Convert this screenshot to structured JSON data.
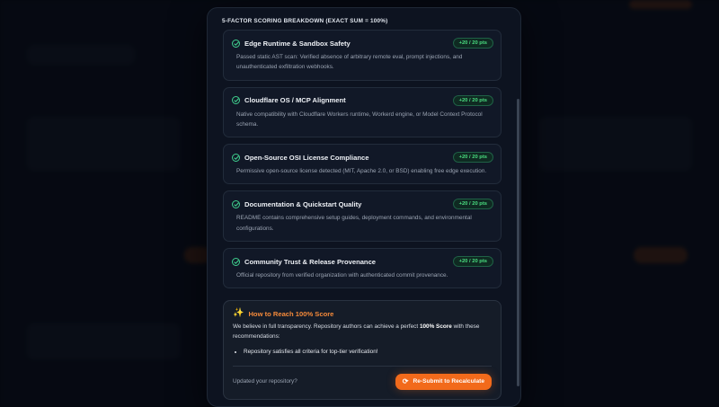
{
  "modal": {
    "section_title": "5-FACTOR SCORING BREAKDOWN (EXACT SUM = 100%)",
    "criteria": [
      {
        "title": "Edge Runtime & Sandbox Safety",
        "points": "+20 / 20 pts",
        "description": "Passed static AST scan: Verified absence of arbitrary remote eval, prompt injections, and unauthenticated exfiltration webhooks."
      },
      {
        "title": "Cloudflare OS / MCP Alignment",
        "points": "+20 / 20 pts",
        "description": "Native compatibility with Cloudflare Workers runtime, Workerd engine, or Model Context Protocol schema."
      },
      {
        "title": "Open-Source OSI License Compliance",
        "points": "+20 / 20 pts",
        "description": "Permissive open-source license detected (MIT, Apache 2.0, or BSD) enabling free edge execution."
      },
      {
        "title": "Documentation & Quickstart Quality",
        "points": "+20 / 20 pts",
        "description": "README contains comprehensive setup guides, deployment commands, and environmental configurations."
      },
      {
        "title": "Community Trust & Release Provenance",
        "points": "+20 / 20 pts",
        "description": "Official repository from verified organization with authenticated commit provenance."
      }
    ],
    "howto": {
      "title": "How to Reach 100% Score",
      "text_before": "We believe in full transparency. Repository authors can achieve a perfect ",
      "text_bold": "100% Score",
      "text_after": " with these recommendations:",
      "items": [
        "Repository satisfies all criteria for top-tier verification!"
      ],
      "updated_label": "Updated your repository?",
      "resubmit_label": "Re-Submit to Recalculate"
    }
  },
  "icons": {
    "criterion_icon": "check-circle-icon",
    "howto_icon": "sparkles-icon",
    "resubmit_icon": "refresh-icon"
  },
  "colors": {
    "accent": "#f26a1b",
    "success": "#4ade80"
  }
}
